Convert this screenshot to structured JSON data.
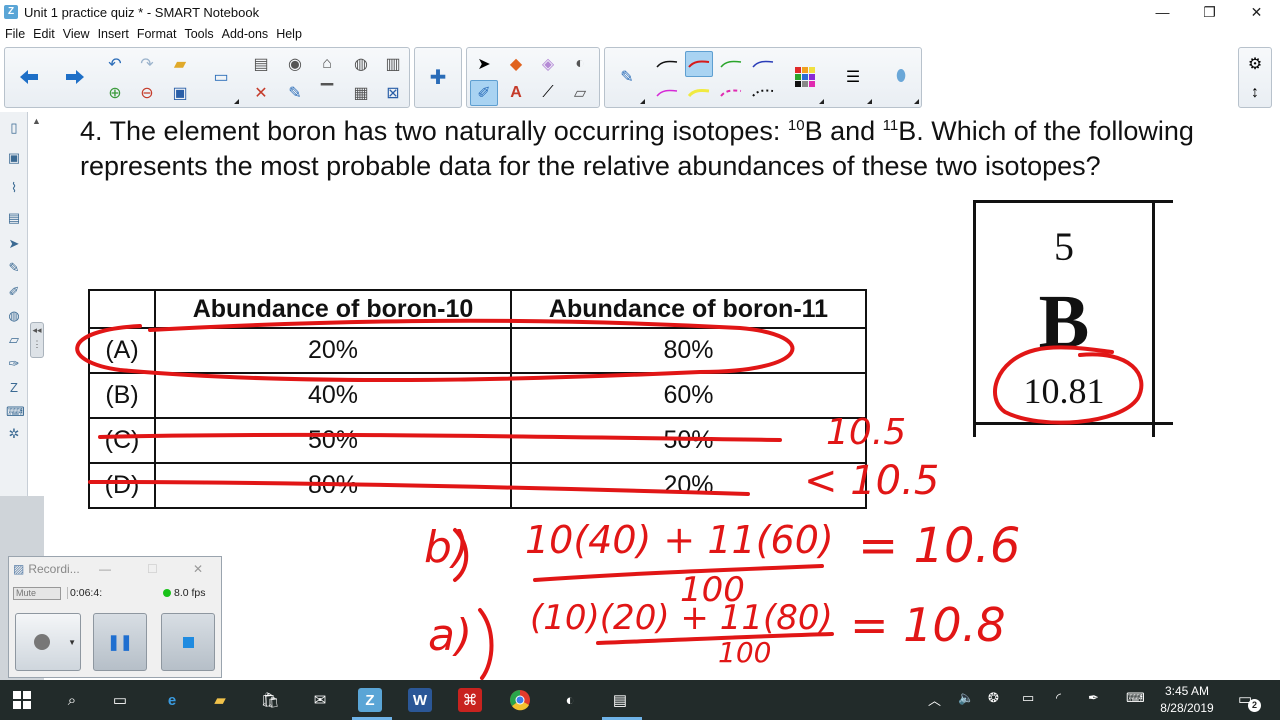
{
  "window": {
    "app_icon_letter": "Z",
    "title": "Unit 1 practice quiz * - SMART Notebook",
    "minimize": "—",
    "restore": "❐",
    "close": "✕"
  },
  "menu": [
    "File",
    "Edit",
    "View",
    "Insert",
    "Format",
    "Tools",
    "Add-ons",
    "Help"
  ],
  "question": {
    "prefix": "4. The element boron has two naturally occurring isotopes: ",
    "iso1_mass": "10",
    "iso1_sym": "B and ",
    "iso2_mass": "11",
    "iso2_sym": "B. Which of the following represents the most probable data for the relative abundances of these two isotopes?"
  },
  "table": {
    "headers": [
      "",
      "Abundance of boron-10",
      "Abundance of boron-11"
    ],
    "rows": [
      [
        "(A)",
        "20%",
        "80%"
      ],
      [
        "(B)",
        "40%",
        "60%"
      ],
      [
        "(C)",
        "50%",
        "50%"
      ],
      [
        "(D)",
        "80%",
        "20%"
      ]
    ]
  },
  "element_tile": {
    "atomic_number": "5",
    "symbol": "B",
    "atomic_mass": "10.81"
  },
  "annotations": {
    "c_note": "10.5",
    "d_note": "< 10.5",
    "b_label": "b)",
    "b_numerator": "10(40) + 11(60)",
    "b_denominator": "100",
    "b_result": "= 10.6",
    "a_label": "a)",
    "a_numerator": "(10)(20) + 11(80)",
    "a_denominator": "100",
    "a_result": "= 10.8"
  },
  "recorder": {
    "title": "Recordi...",
    "mute_label": "Mute",
    "elapsed": "0:06:4:",
    "fps": "8.0 fps",
    "status_color": "#19c219"
  },
  "taskbar": {
    "time": "3:45 AM",
    "date": "8/28/2019",
    "notification_count": "2"
  },
  "colors": {
    "ink": "#e11616",
    "accent": "#5aa5d6"
  }
}
